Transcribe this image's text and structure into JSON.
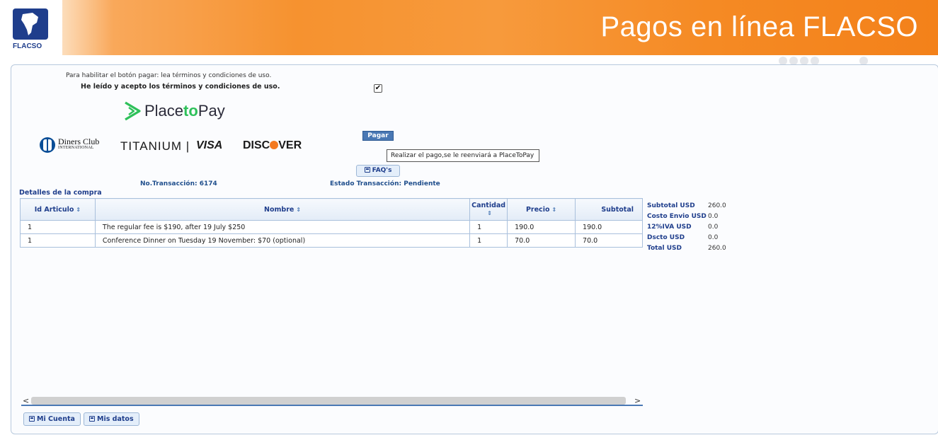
{
  "header": {
    "logo_text": "FLACSO",
    "title": "Pagos en línea FLACSO"
  },
  "terms": {
    "intro": "Para habilitar el botón pagar: lea términos y condiciones de uso.",
    "accept_label": "He leído y acepto los términos y condiciones de uso.",
    "accepted": true,
    "checkbox_glyph": "✔"
  },
  "brands": {
    "ptp_prefix": "Place",
    "ptp_to": "to",
    "ptp_suffix": "Pay",
    "diners_name": "Diners Club",
    "diners_sub": "INTERNATIONAL",
    "titanium": "TITANIUM | ",
    "visa": "VISA",
    "discover_a": "DISC",
    "discover_b": "VER"
  },
  "actions": {
    "pagar_label": "Pagar",
    "pagar_tooltip": "Realizar el pago,se le reenviará a PlaceToPay",
    "faq_label": "FAQ's"
  },
  "transaction": {
    "number": "No.Transacción: 6174",
    "status": "Estado Transacción: Pendiente",
    "details_title": "Detalles de la compra"
  },
  "table": {
    "headers": {
      "id": "Id Articulo",
      "name": "Nombre",
      "qty": "Cantidad",
      "price": "Precio",
      "subtotal": "Subtotal"
    },
    "sort_glyph": "⇕",
    "rows": [
      {
        "id": "1",
        "name": "The regular fee is $190, after 19 July $250",
        "qty": "1",
        "price": "190.0",
        "subtotal": "190.0"
      },
      {
        "id": "1",
        "name": "Conference Dinner on Tuesday 19 November: $70 (optional)",
        "qty": "1",
        "price": "70.0",
        "subtotal": "70.0"
      }
    ]
  },
  "totals": [
    {
      "label": "Subtotal USD",
      "value": "260.0"
    },
    {
      "label": "Costo Envio USD",
      "value": "0.0"
    },
    {
      "label": "12%IVA USD",
      "value": "0.0"
    },
    {
      "label": "Dscto USD",
      "value": "0.0"
    },
    {
      "label": "Total USD",
      "value": "260.0"
    }
  ],
  "scroll": {
    "left": "<",
    "right": ">"
  },
  "footer": {
    "mi_cuenta": "Mi Cuenta",
    "mis_datos": "Mis datos"
  },
  "colors": {
    "brand_blue": "#1f3e8c",
    "header_orange": "#f6922f",
    "ptp_green": "#2ec05a",
    "discover_orange": "#f47a20"
  },
  "icons": [
    "flacso-logo",
    "placetopay-logo",
    "diners-logo",
    "save-icon",
    "check-icon",
    "sort-icon"
  ]
}
